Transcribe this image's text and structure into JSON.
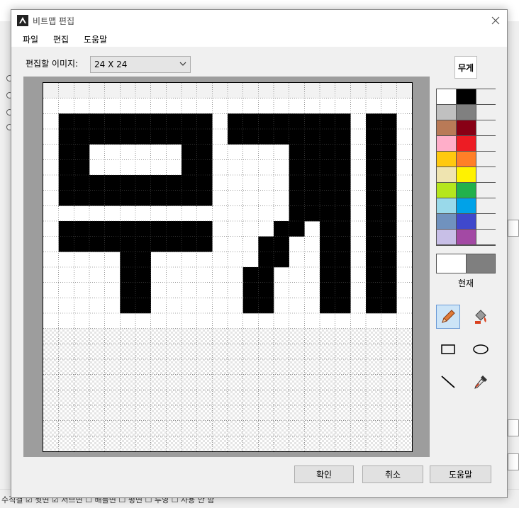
{
  "window": {
    "title": "비트맵 편집"
  },
  "menu": [
    "파일",
    "편집",
    "도움말"
  ],
  "image_selector": {
    "label": "편집할 이미지:",
    "value": "24 X 24"
  },
  "preview": {
    "text": "무게"
  },
  "grid": {
    "cols": 24,
    "rows": 24,
    "rows_data": [
      "........................",
      "........................",
      ".##########...######.##.",
      ".##########...######.##.",
      ".##..####.##....####.##.",
      ".##......##.....####.##.",
      ".##########.....######..",
      ".##########.....######..",
      "..................###.##.",
      ".##########....###..##.",
      ".##########...##....##.",
      "....##.......##.....##..",
      "....##......##......##.."
    ]
  },
  "palette": [
    "#ffffff",
    "#000000",
    "#f0f0f0",
    "#c0c0c0",
    "#808080",
    "#f0f0f0",
    "#b97a57",
    "#880015",
    "#f0f0f0",
    "#ffaec9",
    "#ed1c24",
    "#f0f0f0",
    "#ffc90e",
    "#ff7f27",
    "#f0f0f0",
    "#efe4b0",
    "#fff200",
    "#f0f0f0",
    "#b5e61d",
    "#22b14c",
    "#f0f0f0",
    "#99d9ea",
    "#00a2e8",
    "#f0f0f0",
    "#7092be",
    "#3f48cc",
    "#f0f0f0",
    "#c8bfe7",
    "#a349a4",
    "#f0f0f0"
  ],
  "current": {
    "label": "현재",
    "foreground": "#ffffff",
    "background": "#7f7f7f"
  },
  "tools": [
    "pencil-icon",
    "fill-bucket-icon",
    "rectangle-icon",
    "ellipse-icon",
    "line-icon",
    "eyedropper-icon"
  ],
  "buttons": {
    "ok": "확인",
    "cancel": "취소",
    "help": "도움말"
  },
  "background_app": {
    "bottom_text": "수직결 ☑ 뒷면 ☑ 서브면 ☐ 배틀면 ☐ 평면 ☐ 투영 ☐ 사용 안 함"
  }
}
